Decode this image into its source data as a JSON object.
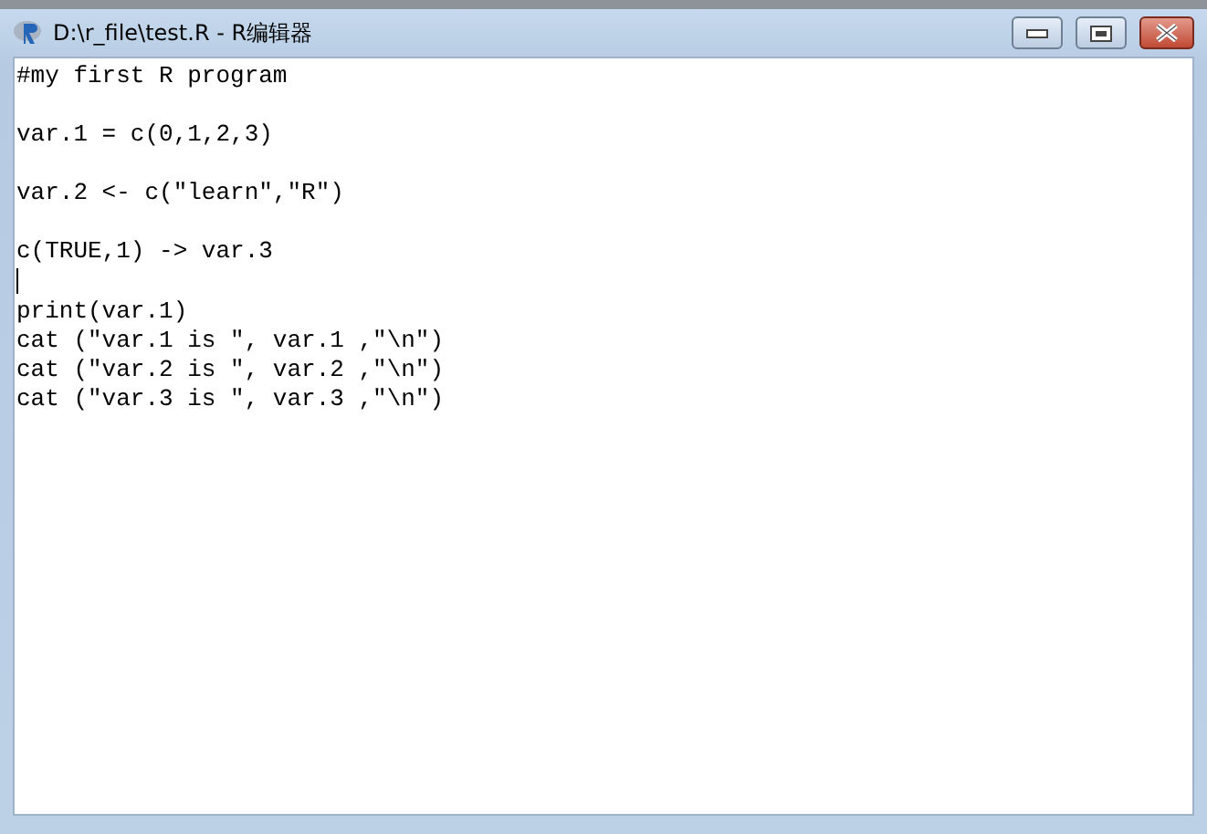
{
  "window": {
    "title": "D:\\r_file\\test.R - R编辑器"
  },
  "editor": {
    "lines": [
      {
        "kind": "code",
        "text": "#my first R program"
      },
      {
        "kind": "blank"
      },
      {
        "kind": "code",
        "text": "var.1 = c(0,1,2,3)"
      },
      {
        "kind": "blank"
      },
      {
        "kind": "code",
        "text": "var.2 <- c(\"learn\",\"R\")"
      },
      {
        "kind": "blank"
      },
      {
        "kind": "code",
        "text": "c(TRUE,1) -> var.3"
      },
      {
        "kind": "caret"
      },
      {
        "kind": "code",
        "text": "print(var.1)"
      },
      {
        "kind": "code",
        "text": "cat (\"var.1 is \", var.1 ,\"\\n\")"
      },
      {
        "kind": "code",
        "text": "cat (\"var.2 is \", var.2 ,\"\\n\")"
      },
      {
        "kind": "code",
        "text": "cat (\"var.3 is \", var.3 ,\"\\n\")"
      }
    ]
  }
}
